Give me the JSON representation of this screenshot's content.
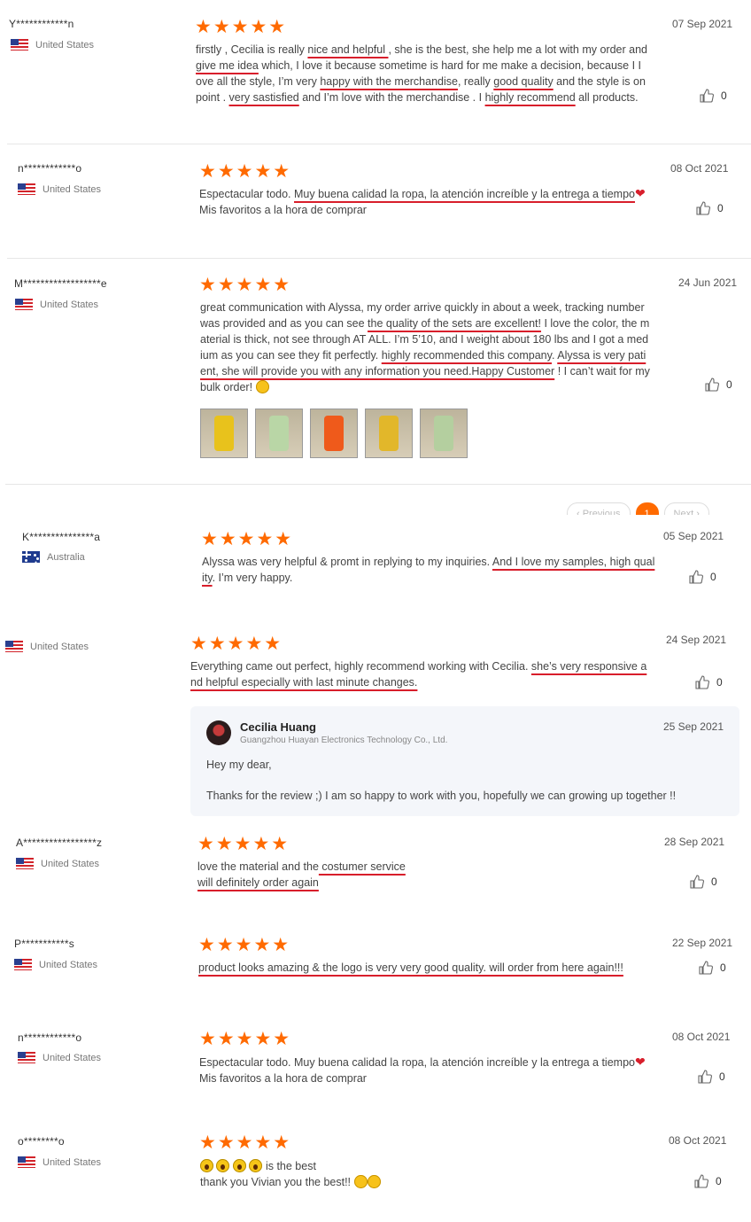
{
  "reviews": [
    {
      "user": "Y************n",
      "country": "United States",
      "date": "07 Sep 2021",
      "likes": "0",
      "lines": [
        "firstly , Cecilia is really nice and helpful , she is the best,  she help me a lot with my order and",
        "give me idea which, I love it because sometime is  hard for me make a decision,  because I I",
        "ove all the style, I’m very happy with the merchandise, really good quality and the style is on",
        "point . very sastisfied and I’m love with the merchandise . I highly recommend all products."
      ]
    },
    {
      "user": "n************o",
      "country": "United States",
      "date": "08 Oct 2021",
      "likes": "0",
      "lines": [
        "Espectacular todo. Muy buena calidad la ropa, la atención increíble y la entrega a tiempo",
        "Mis favoritos a la hora de comprar"
      ]
    },
    {
      "user": "M******************e",
      "country": "United States",
      "date": "24 Jun 2021",
      "likes": "0",
      "lines": [
        "great communication with Alyssa, my order arrive quickly in about a week, tracking number",
        "was provided and as you can see the quality of the sets are excellent! I love the color, the m",
        "aterial is thick, not see through AT ALL. I’m 5’10, and I weight  about 180 lbs and I got a med",
        "ium as you can see they fit perfectly. highly recommended this company. Alyssa is very pati",
        "ent, she will provide you with any information you need.Happy Customer ! I can’t wait for my",
        "bulk order!"
      ]
    },
    {
      "user": "K***************a",
      "country": "Australia",
      "date": "05 Sep 2021",
      "likes": "0",
      "lines": [
        "Alyssa was very helpful & promt in replying to my inquiries. And I love my samples, high qual",
        "ity. I’m very happy."
      ]
    },
    {
      "user": "",
      "country": "United States",
      "date": "24 Sep 2021",
      "likes": "0",
      "lines": [
        "Everything came out perfect, highly recommend working with Cecilia. she’s very responsive a",
        "nd helpful especially with last minute changes."
      ]
    },
    {
      "user": "A*****************z",
      "country": "United States",
      "date": "28 Sep 2021",
      "likes": "0",
      "lines": [
        "love the material and the costumer service",
        "will definitely order again"
      ]
    },
    {
      "user": "P***********s",
      "country": "United States",
      "date": "22 Sep 2021",
      "likes": "0",
      "lines": [
        "product looks amazing & the logo is very very good quality. will order from here again!!!"
      ]
    },
    {
      "user": "n************o",
      "country": "United States",
      "date": "08 Oct 2021",
      "likes": "0",
      "lines": [
        "Espectacular todo. Muy buena calidad la ropa, la atención increíble y la entrega a tiempo",
        "Mis favoritos a la hora de comprar"
      ]
    },
    {
      "user": "o********o",
      "country": "United States",
      "date": "08 Oct 2021",
      "likes": "0",
      "lines": [
        "is the best",
        "thank you Vivian you the best!!"
      ]
    }
  ],
  "stars": "★★★★★",
  "reply": {
    "name": "Cecilia Huang",
    "company": "Guangzhou Huayan Electronics Technology Co., Ltd.",
    "date": "25 Sep 2021",
    "greeting": "Hey my dear,",
    "body": "Thanks for the review ;) I am so happy to work with you, hopefully we can growing up together !!"
  },
  "pagination": {
    "previous": "‹ Previous",
    "current": "1",
    "next": "Next ›"
  },
  "colors": {
    "accent": "#ff6a00",
    "underline": "#d81e2b"
  }
}
